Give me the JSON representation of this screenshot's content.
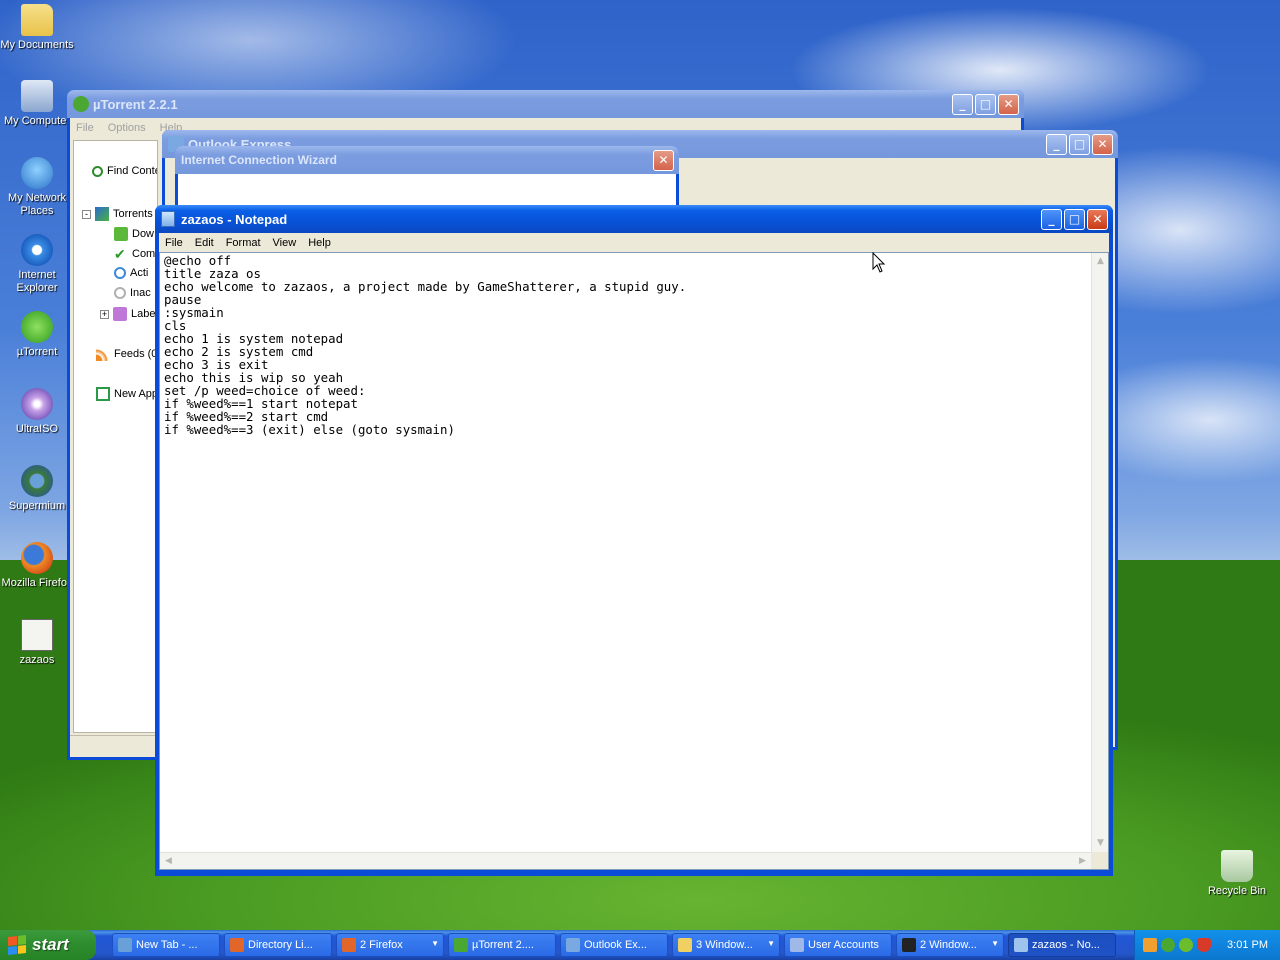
{
  "desktop": {
    "icons": [
      {
        "label": "My Documents",
        "icon": "folder-documents-icon"
      },
      {
        "label": "My Computer",
        "icon": "computer-icon"
      },
      {
        "label": "My Network Places",
        "icon": "network-icon"
      },
      {
        "label": "Internet Explorer",
        "icon": "internet-explorer-icon"
      },
      {
        "label": "µTorrent",
        "icon": "utorrent-icon"
      },
      {
        "label": "UltraISO",
        "icon": "ultraiso-icon"
      },
      {
        "label": "Supermium",
        "icon": "supermium-icon"
      },
      {
        "label": "Mozilla Firefox",
        "icon": "firefox-icon"
      },
      {
        "label": "zazaos",
        "icon": "batch-file-icon"
      },
      {
        "label": "Recycle Bin",
        "icon": "recycle-bin-icon"
      }
    ]
  },
  "utorrent": {
    "title": "µTorrent 2.2.1",
    "menu": [
      "File",
      "Options",
      "Help"
    ],
    "find_content": "Find Conte",
    "torrents": "Torrents",
    "items": [
      "Dow",
      "Com",
      "Acti",
      "Inac",
      "Labe"
    ],
    "feeds": "Feeds (0",
    "new_apps": "New App"
  },
  "outlook": {
    "title": "Outlook Express"
  },
  "wizard": {
    "title": "Internet Connection Wizard"
  },
  "notepad": {
    "title": "zazaos - Notepad",
    "menu": [
      "File",
      "Edit",
      "Format",
      "View",
      "Help"
    ],
    "content": "@echo off\ntitle zaza os\necho welcome to zazaos, a project made by GameShatterer, a stupid guy.\npause\n:sysmain\ncls\necho 1 is system notepad\necho 2 is system cmd\necho 3 is exit\necho this is wip so yeah\nset /p weed=choice of weed:\nif %weed%==1 start notepat\nif %weed%==2 start cmd\nif %weed%==3 (exit) else (goto sysmain)"
  },
  "window_buttons": {
    "minimize": "_",
    "maximize": "□",
    "close": "✕"
  },
  "taskbar": {
    "start_label": "start",
    "tasks": [
      {
        "label": "New Tab - ...",
        "icon": "supermium-icon",
        "color": "#6aa0d8"
      },
      {
        "label": "Directory Li...",
        "icon": "firefox-icon",
        "color": "#e0662a"
      },
      {
        "label": "2 Firefox",
        "icon": "firefox-icon",
        "color": "#e0662a",
        "group": true
      },
      {
        "label": "µTorrent 2....",
        "icon": "utorrent-icon",
        "color": "#4aa832"
      },
      {
        "label": "Outlook Ex...",
        "icon": "outlook-icon",
        "color": "#7aa8e0"
      },
      {
        "label": "3 Window...",
        "icon": "folder-icon",
        "color": "#f0d060",
        "group": true
      },
      {
        "label": "User Accounts",
        "icon": "user-accounts-icon",
        "color": "#a0b8e8"
      },
      {
        "label": "2 Window...",
        "icon": "cmd-icon",
        "color": "#222222",
        "group": true
      },
      {
        "label": "zazaos - No...",
        "icon": "notepad-icon",
        "color": "#9ec4ee",
        "active": true
      }
    ],
    "clock": "3:01 PM"
  }
}
